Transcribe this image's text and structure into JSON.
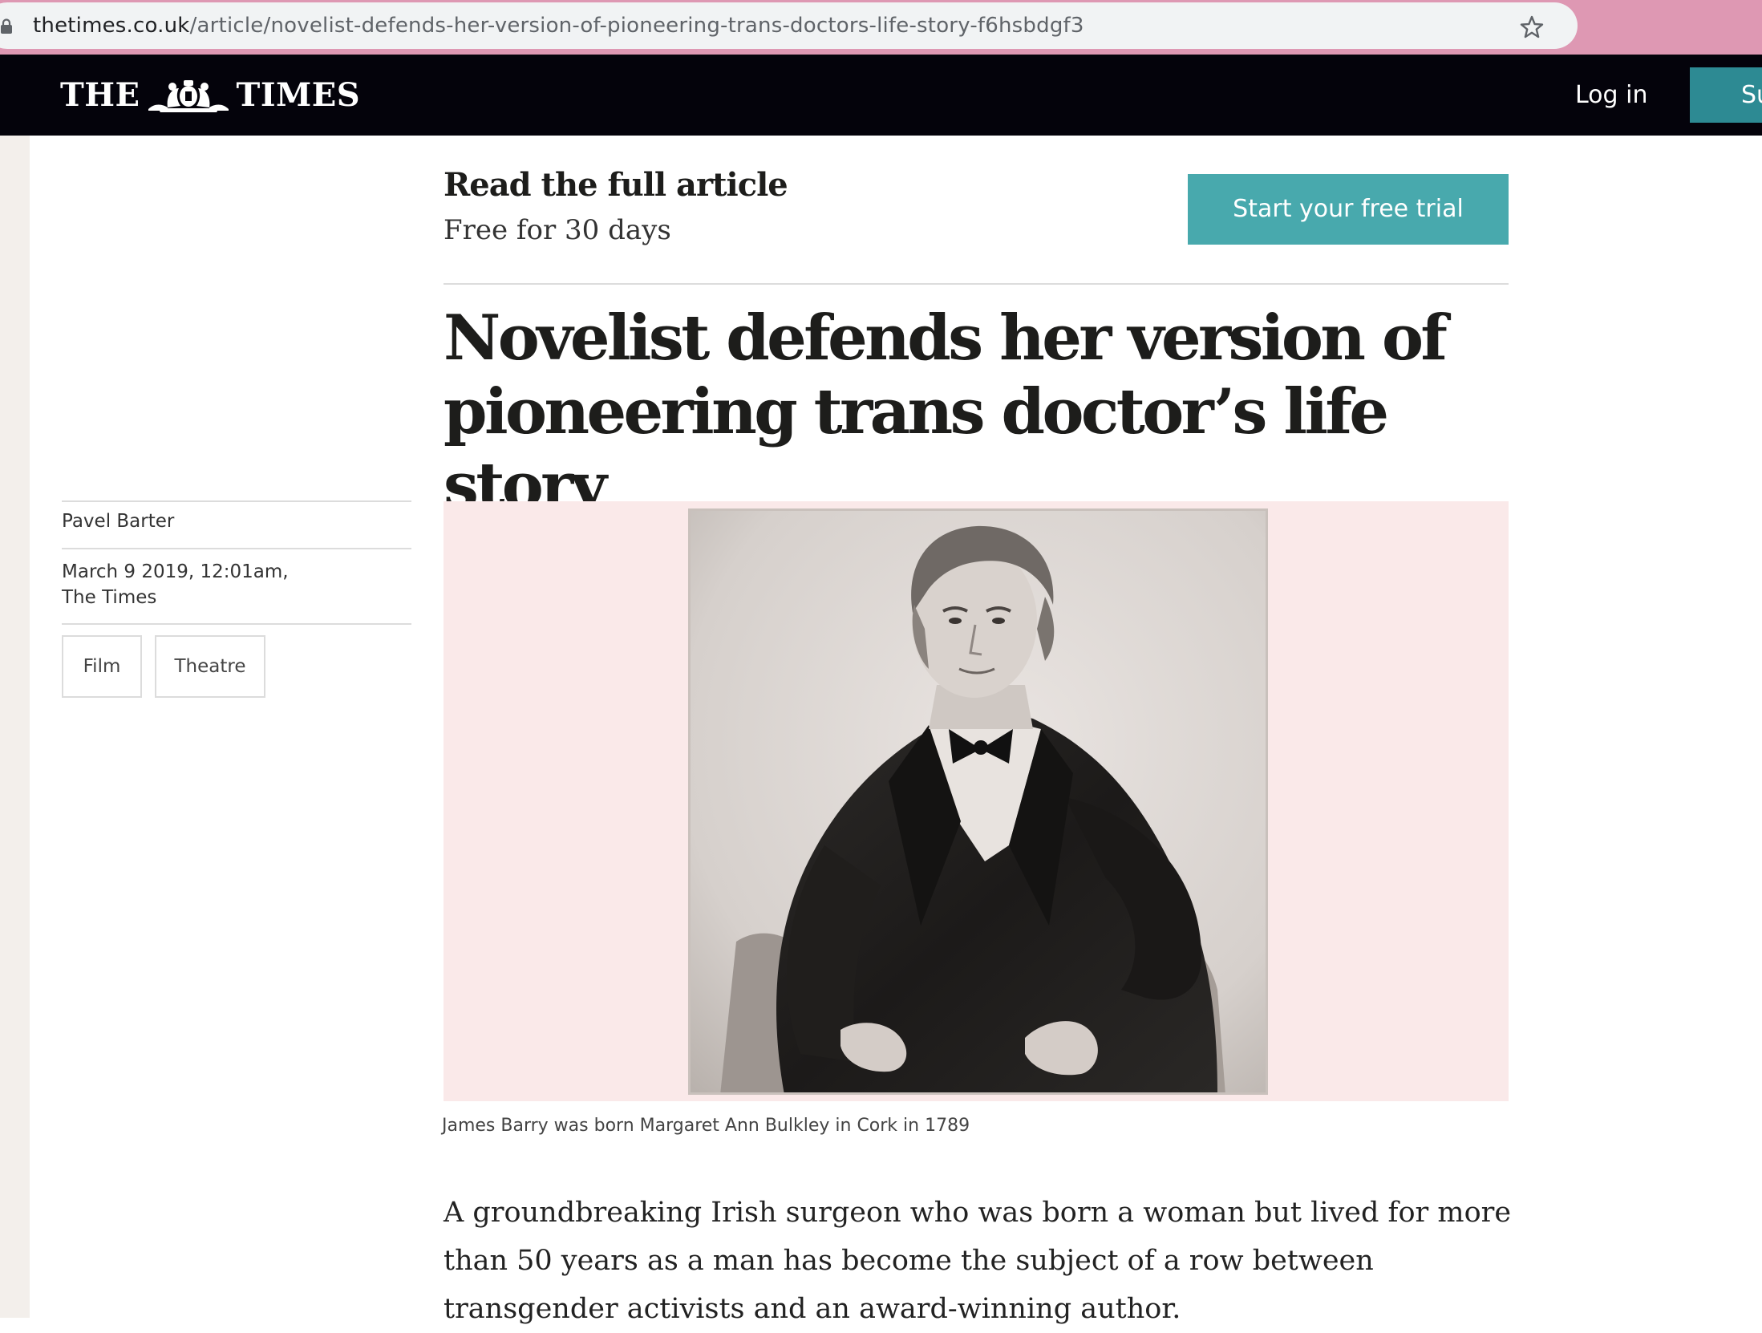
{
  "browser": {
    "url_domain": "thetimes.co.uk",
    "url_path": "/article/novelist-defends-her-version-of-pioneering-trans-doctors-life-story-f6hsbdgf3",
    "icons": {
      "lock": "lock-icon",
      "bookmark": "star-icon"
    }
  },
  "header": {
    "logo_left": "THE",
    "logo_right": "TIMES",
    "login_label": "Log in",
    "subscribe_label": "Su",
    "background_color": "#04030b",
    "accent_color": "#2d8a93"
  },
  "paywall": {
    "title": "Read the full article",
    "subtitle": "Free for 30 days",
    "cta_label": "Start your free trial",
    "cta_color": "#48a9ad"
  },
  "article": {
    "headline": "Novelist defends her version of pioneering trans doctor’s life story",
    "author": "Pavel Barter",
    "date_line_1": "March 9 2019, 12:01am,",
    "date_line_2": "The Times",
    "tags": [
      "Film",
      "Theatre"
    ],
    "image_caption": "James Barry was born Margaret Ann Bulkley in Cork in 1789",
    "body_lead": "A groundbreaking Irish surgeon who was born a woman but lived for more than 50 years as a man has become the subject of a row between transgender activists and an award-winning author."
  }
}
